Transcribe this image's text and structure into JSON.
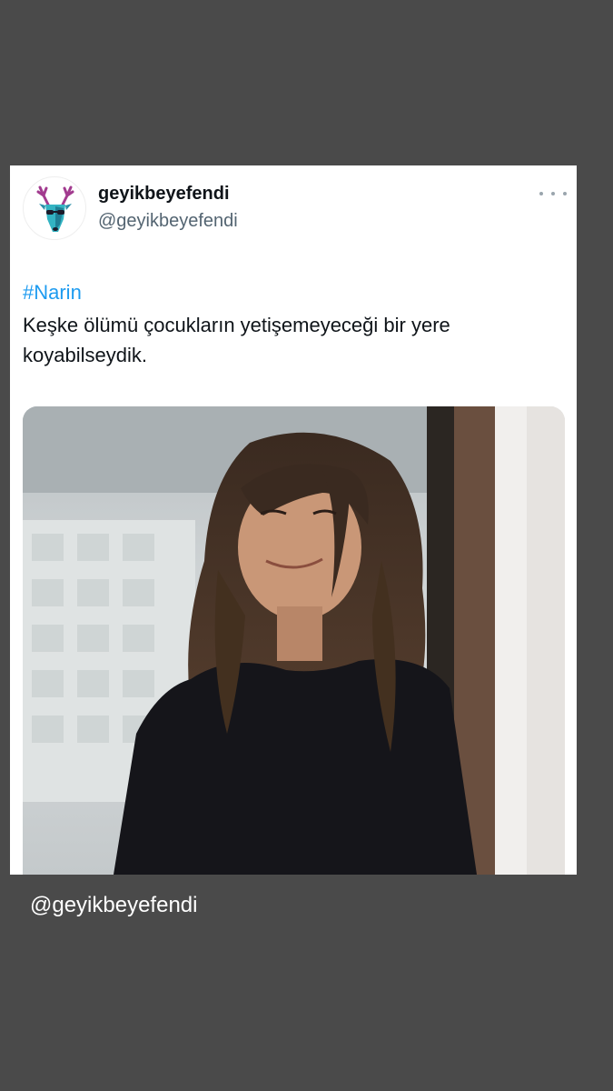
{
  "tweet": {
    "author": {
      "display_name": "geyikbeyefendi",
      "handle": "@geyikbeyefendi",
      "avatar_icon": "deer-head-icon"
    },
    "more_icon": "ellipsis-icon",
    "hashtag": "#Narin",
    "text": "Keşke ölümü çocukların yetişemeyeceği bir yere koyabilseydik.",
    "media": {
      "type": "photo",
      "subject": "smiling child with long brown hair in a black top"
    }
  },
  "overlay": {
    "watermark": "@geyikbeyefendi"
  },
  "colors": {
    "background": "#4a4a4a",
    "card": "#ffffff",
    "hashtag": "#1d9bf0",
    "handle": "#536471",
    "text": "#0f1419"
  }
}
